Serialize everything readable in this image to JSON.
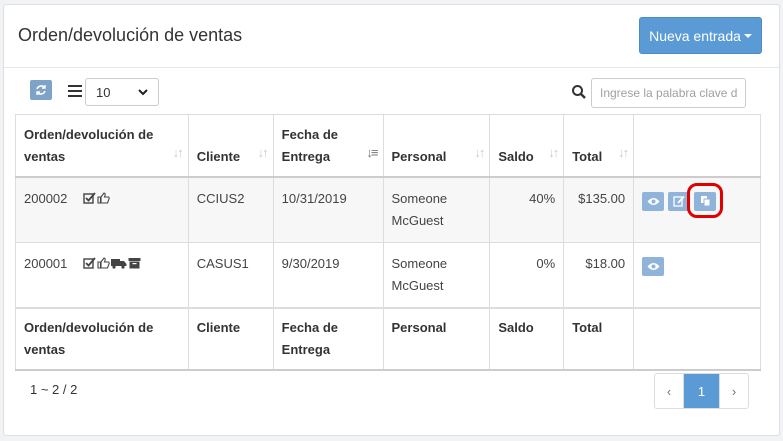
{
  "header": {
    "title": "Orden/devolución de ventas",
    "new_button": "Nueva entrada"
  },
  "toolbar": {
    "page_size": "10",
    "search_placeholder": "Ingrese la palabra clave d"
  },
  "table": {
    "columns": [
      "Orden/devolución de ventas",
      "Cliente",
      "Fecha de Entrega",
      "Personal",
      "Saldo",
      "Total"
    ],
    "rows": [
      {
        "order": "200002",
        "client": "CCIUS2",
        "date": "10/31/2019",
        "staff": "Someone McGuest",
        "balance": "40%",
        "total": "$135.00"
      },
      {
        "order": "200001",
        "client": "CASUS1",
        "date": "9/30/2019",
        "staff": "Someone McGuest",
        "balance": "0%",
        "total": "$18.00"
      }
    ],
    "footer_columns": [
      "Orden/devolución de ventas",
      "Cliente",
      "Fecha de Entrega",
      "Personal",
      "Saldo",
      "Total"
    ]
  },
  "pagination": {
    "info": "1 ~ 2 / 2",
    "prev": "‹",
    "current": "1",
    "next": "›"
  },
  "colors": {
    "accent": "#5b9bd5",
    "action_button": "#8fb3d9",
    "highlight": "#e00000"
  }
}
